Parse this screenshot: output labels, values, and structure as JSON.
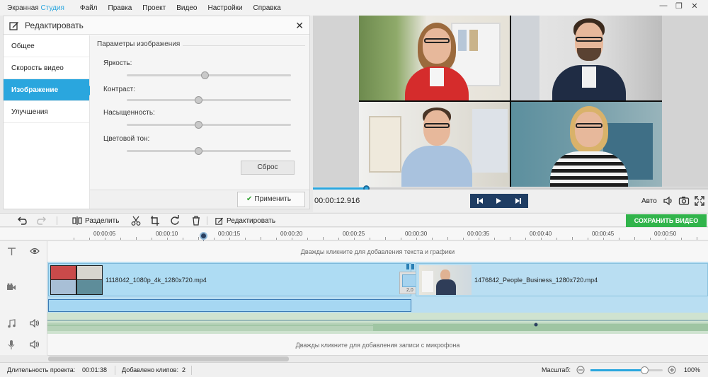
{
  "app": {
    "name_prefix": "Экранная ",
    "name_accent": "Студия",
    "accent_color": "#2aa6de"
  },
  "menu": [
    "Файл",
    "Правка",
    "Проект",
    "Видео",
    "Настройки",
    "Справка"
  ],
  "window_controls": [
    "—",
    "❐",
    "✕"
  ],
  "edit_panel": {
    "title": "Редактировать",
    "close": "✕",
    "nav": [
      "Общее",
      "Скорость видео",
      "Изображение",
      "Улучшения"
    ],
    "active_nav": "Изображение",
    "group_title": "Параметры изображения",
    "params": [
      {
        "label": "Яркость:",
        "value": 0.48
      },
      {
        "label": "Контраст:",
        "value": 0.44
      },
      {
        "label": "Насыщенность:",
        "value": 0.44
      },
      {
        "label": "Цветовой тон:",
        "value": 0.44
      }
    ],
    "reset": "Сброс",
    "apply": "Применить"
  },
  "player": {
    "timecode": "00:00:12.916",
    "progress": 0.136,
    "auto": "Авто",
    "buttons": [
      "prev-frame-icon",
      "play-icon",
      "next-frame-icon"
    ]
  },
  "toolbar": {
    "split": "Разделить",
    "edit": "Редактировать",
    "save": "СОХРАНИТЬ ВИДЕО",
    "save_color": "#31b44b"
  },
  "ruler": [
    "00:00:05",
    "00:00:10",
    "00:00:15",
    "00:00:20",
    "00:00:25",
    "00:00:30",
    "00:00:35",
    "00:00:40",
    "00:00:45",
    "00:00:50"
  ],
  "tracks": {
    "text_hint": "Дважды кликните для добавления текста и графики",
    "mic_hint": "Дважды кликните для добавления записи с микрофона",
    "clip1_name": "1118042_1080p_4k_1280x720.mp4",
    "clip2_name": "1476842_People_Business_1280x720.mp4",
    "transition_value": "2,0"
  },
  "status": {
    "duration_label": "Длительность проекта:",
    "duration_value": "00:01:38",
    "clips_label": "Добавлено клипов:",
    "clips_value": "2",
    "scale_label": "Масштаб:",
    "zoom_value": "100%",
    "zoom_level": 0.75
  }
}
